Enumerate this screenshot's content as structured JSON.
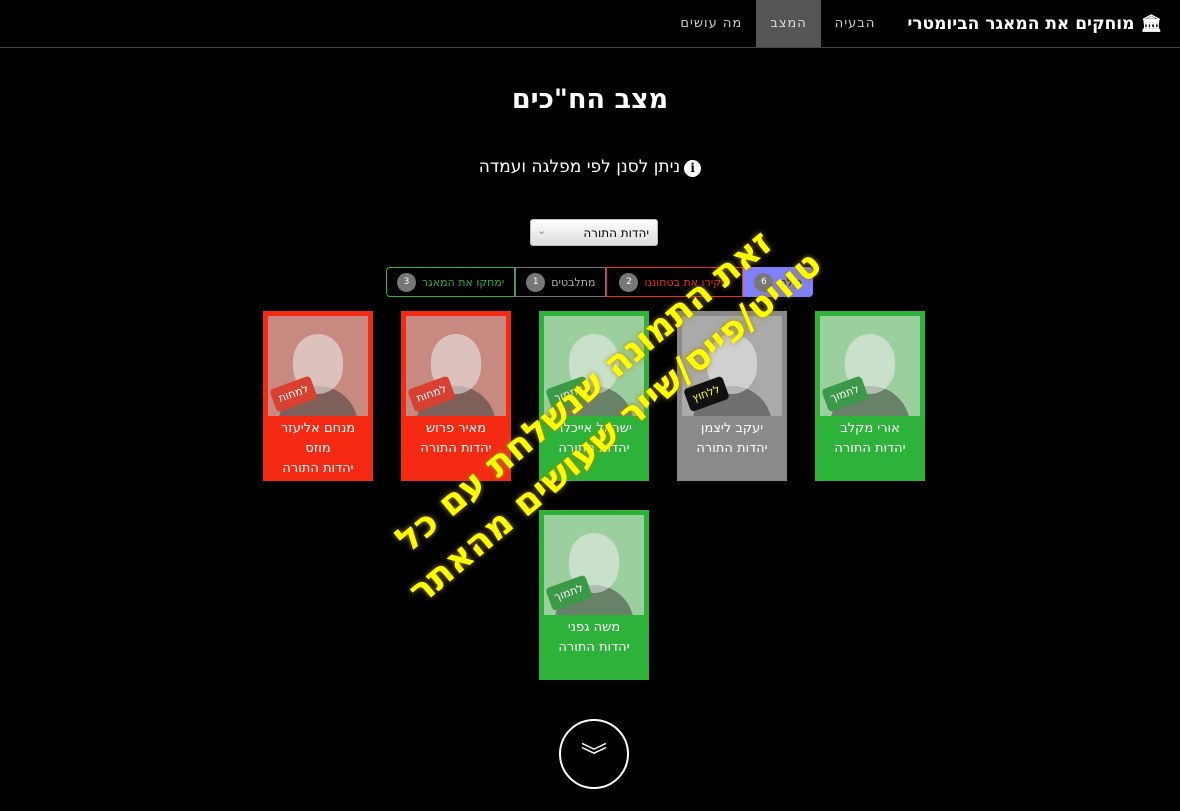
{
  "nav": {
    "brand": "מוחקים את המאגר הביומטרי",
    "items": [
      "הבעיה",
      "המצב",
      "מה עושים"
    ],
    "active": 1
  },
  "title": "מצב הח\"כים",
  "hint": "ניתן לסנן לפי מפלגה ועמדה",
  "filter": {
    "selected": "יהדות התורה"
  },
  "tabs": [
    {
      "label": "כולם",
      "count": "6"
    },
    {
      "label": "יפקירו את בטחוננו",
      "count": "2"
    },
    {
      "label": "מתלבטים",
      "count": "1"
    },
    {
      "label": "ימחקו את המאגר",
      "count": "3"
    }
  ],
  "cards": [
    {
      "name": "אורי מקלב",
      "party": "יהדות התורה",
      "stamp": "לתמוך",
      "status": "support"
    },
    {
      "name": "יעקב ליצמן",
      "party": "יהדות התורה",
      "stamp": "ללחוץ",
      "status": "undecided"
    },
    {
      "name": "ישראל אייכלר",
      "party": "יהדות התורה",
      "stamp": "לתמוך",
      "status": "support"
    },
    {
      "name": "מאיר פרוש",
      "party": "יהדות התורה",
      "stamp": "למחות",
      "status": "oppose"
    },
    {
      "name": "מנחם אליעזר מוזס",
      "party": "יהדות התורה",
      "stamp": "למחות",
      "status": "oppose"
    },
    {
      "name": "משה גפני",
      "party": "יהדות התורה",
      "stamp": "לתמוך",
      "status": "support"
    }
  ],
  "overlay": {
    "line1": "זאת התמונה שנשלחת עם כל",
    "line2": "טוויט/פייס/שייר שעושים מהאתר"
  },
  "colors": {
    "support": "#2db33a",
    "oppose": "#f52a12",
    "undecided": "#8a8a8a",
    "all": "#8080ff"
  }
}
